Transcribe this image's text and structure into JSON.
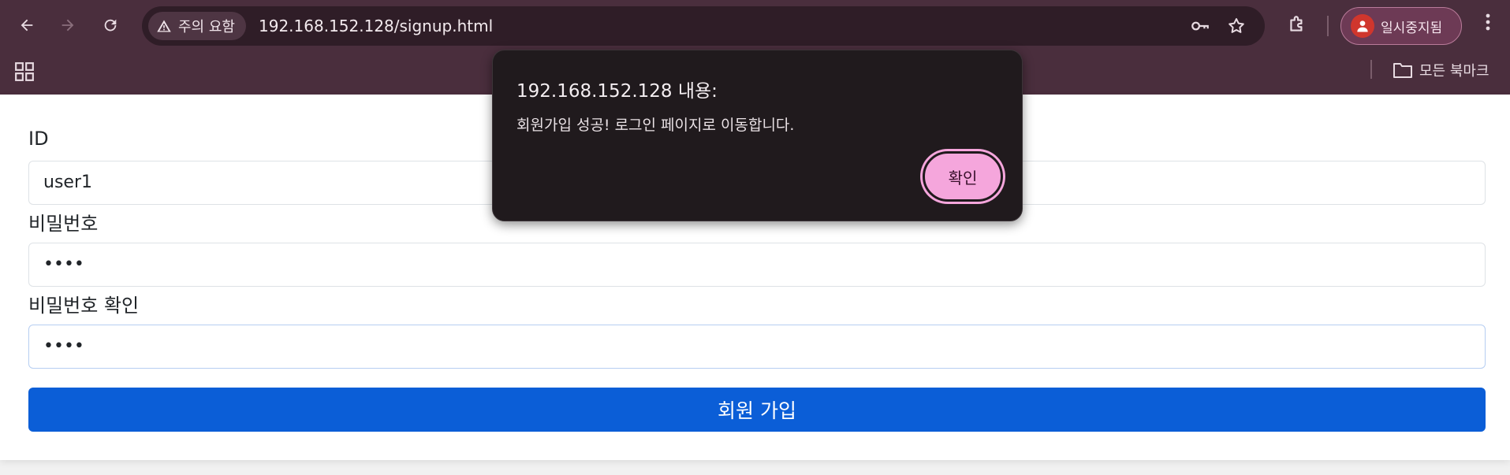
{
  "browser": {
    "security_chip": "주의 요함",
    "url": "192.168.152.128/signup.html",
    "profile_label": "일시중지됨",
    "all_bookmarks": "모든 북마크"
  },
  "form": {
    "id_label": "ID",
    "id_value": "user1",
    "password_label": "비밀번호",
    "password_value": "••••",
    "password_confirm_label": "비밀번호 확인",
    "password_confirm_value": "••••",
    "submit_label": "회원 가입"
  },
  "dialog": {
    "title": "192.168.152.128 내용:",
    "message": "회원가입 성공! 로그인 페이지로 이동합니다.",
    "ok_label": "확인"
  },
  "colors": {
    "chrome": "#4a2e3d",
    "primary": "#0b5ed7",
    "dialog_bg": "#201a1d",
    "dialog_button": "#f5a6dc"
  }
}
